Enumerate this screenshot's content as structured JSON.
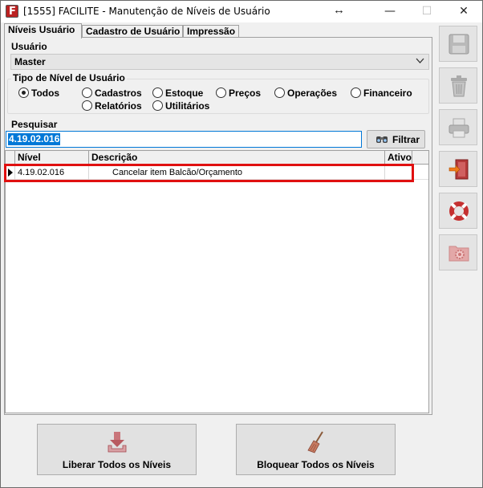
{
  "window": {
    "title": "[1555] FACILITE - Manutenção de Níveis de Usuário",
    "resize_glyph": "↔",
    "minimize_glyph": "—",
    "maximize_glyph": "☐",
    "close_glyph": "✕"
  },
  "app_icon_letter": "F",
  "tabs": [
    {
      "label": "Níveis Usuário",
      "active": true
    },
    {
      "label": "Cadastro de Usuário",
      "active": false
    },
    {
      "label": "Impressão",
      "active": false
    }
  ],
  "usuario": {
    "label": "Usuário",
    "selected": "Master"
  },
  "tipo_nivel": {
    "label": "Tipo de Nível de Usuário",
    "options": [
      {
        "label": "Todos",
        "selected": true
      },
      {
        "label": "Cadastros",
        "selected": false
      },
      {
        "label": "Estoque",
        "selected": false
      },
      {
        "label": "Preços",
        "selected": false
      },
      {
        "label": "Operações",
        "selected": false
      },
      {
        "label": "Financeiro",
        "selected": false
      },
      {
        "label": "Relatórios",
        "selected": false
      },
      {
        "label": "Utilitários",
        "selected": false
      }
    ]
  },
  "pesquisar": {
    "label": "Pesquisar",
    "value": "4.19.02.016",
    "filter_button": "Filtrar"
  },
  "grid": {
    "columns": [
      "Nível",
      "Descrição",
      "Ativo"
    ],
    "rows": [
      {
        "nivel": "4.19.02.016",
        "descricao": "Cancelar item Balcão/Orçamento",
        "ativo": ""
      }
    ]
  },
  "buttons": {
    "liberar": "Liberar Todos os Níveis",
    "bloquear": "Bloquear Todos os Níveis"
  },
  "side_toolbar": [
    {
      "icon": "save-icon",
      "enabled": false
    },
    {
      "icon": "trash-icon",
      "enabled": false
    },
    {
      "icon": "printer-icon",
      "enabled": false
    },
    {
      "icon": "exit-door-icon",
      "enabled": true
    },
    {
      "icon": "lifebuoy-icon",
      "enabled": true
    },
    {
      "icon": "folder-gear-icon",
      "enabled": false
    }
  ],
  "colors": {
    "highlight_border": "#e01010",
    "selection_blue": "#0078d7"
  }
}
